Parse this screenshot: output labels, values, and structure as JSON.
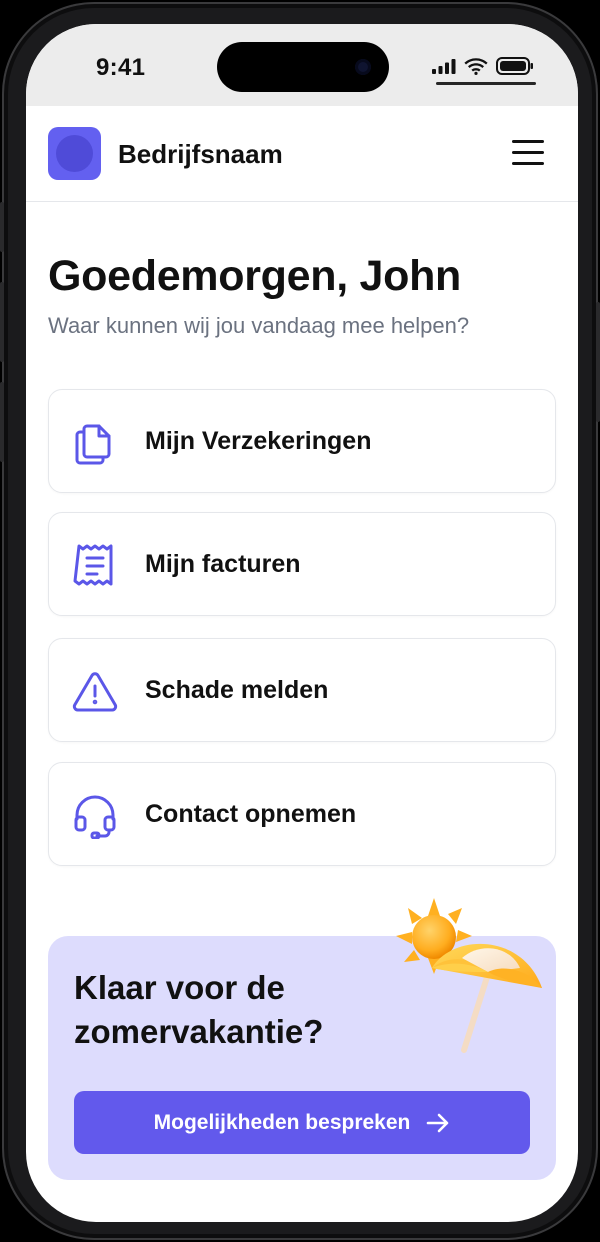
{
  "status_bar": {
    "time": "9:41"
  },
  "header": {
    "company_name": "Bedrijfsnaam"
  },
  "greeting": {
    "title": "Goedemorgen, John",
    "subtitle": "Waar kunnen wij jou vandaag mee helpen?"
  },
  "menu_items": [
    {
      "label": "Mijn Verzekeringen",
      "icon": "documents-icon"
    },
    {
      "label": "Mijn facturen",
      "icon": "receipt-icon"
    },
    {
      "label": "Schade melden",
      "icon": "warning-icon"
    },
    {
      "label": "Contact opnemen",
      "icon": "headset-icon"
    }
  ],
  "promo": {
    "title": "Klaar voor de zomervakantie?",
    "button_label": "Mogelijkheden bespreken",
    "illustration": "sun-umbrella-illustration"
  },
  "colors": {
    "accent": "#6259ec",
    "icon": "#5b57e8",
    "promo_background": "#dddcfd",
    "subtitle": "#6b7280"
  }
}
